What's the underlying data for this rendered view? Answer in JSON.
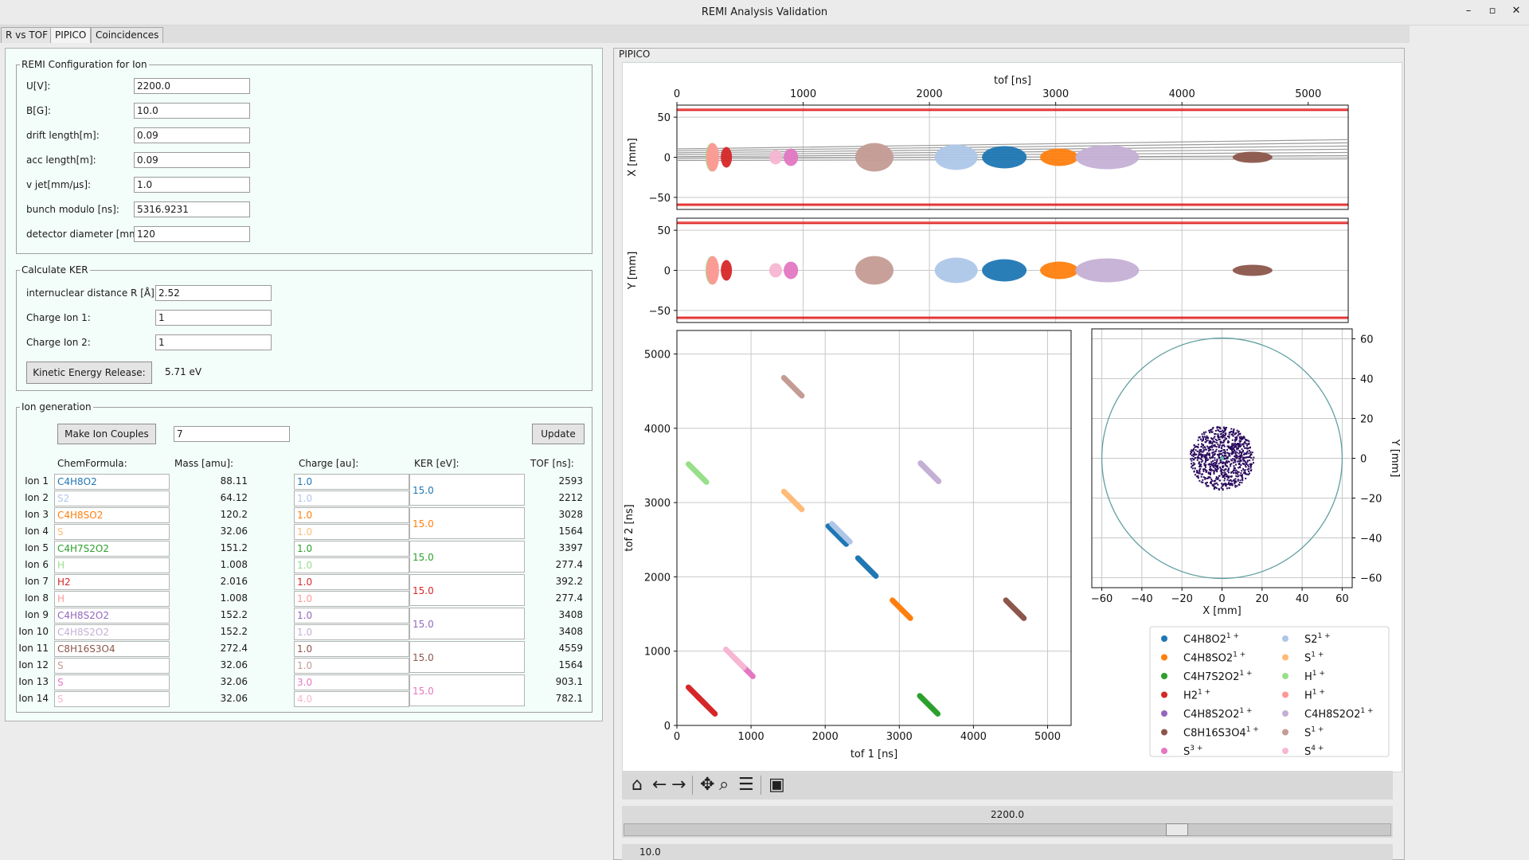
{
  "window": {
    "title": "REMI Analysis Validation",
    "minimize": "–",
    "maximize": "▫",
    "close": "✕"
  },
  "tabs": [
    "R vs TOF",
    "PIPICO",
    "Coincidences"
  ],
  "config": {
    "title": "REMI Configuration for Ion",
    "rows": [
      {
        "label": "U[V]:",
        "value": "2200.0"
      },
      {
        "label": "B[G]:",
        "value": "10.0"
      },
      {
        "label": "drift length[m]:",
        "value": "0.09"
      },
      {
        "label": "acc length[m]:",
        "value": "0.09"
      },
      {
        "label": "v jet[mm/µs]:",
        "value": "1.0"
      },
      {
        "label": "bunch modulo [ns]:",
        "value": "5316.9231"
      },
      {
        "label": "detector diameter [mm]:",
        "value": "120"
      }
    ]
  },
  "ker": {
    "title": "Calculate KER",
    "rows": [
      {
        "label": "internuclear distance R [Å]:",
        "value": "2.52"
      },
      {
        "label": "Charge Ion 1:",
        "value": "1"
      },
      {
        "label": "Charge Ion 2:",
        "value": "1"
      }
    ],
    "button": "Kinetic Energy Release:",
    "result": "5.71 eV"
  },
  "iongen": {
    "title": "Ion generation",
    "make_button": "Make Ion Couples",
    "couples": "7",
    "update_button": "Update",
    "headers": {
      "formula": "ChemFormula:",
      "mass": "Mass [amu]:",
      "charge": "Charge [au]:",
      "ker": "KER [eV]:",
      "tof": "TOF [ns]:"
    },
    "ions": [
      {
        "label": "Ion 1",
        "formula": "C4H8O2",
        "mass": "88.11",
        "charge": "1.0",
        "tof": "2593",
        "color": "#1f77b4"
      },
      {
        "label": "Ion 2",
        "formula": "S2",
        "mass": "64.12",
        "charge": "1.0",
        "tof": "2212",
        "color": "#aec7e8"
      },
      {
        "label": "Ion 3",
        "formula": "C4H8SO2",
        "mass": "120.2",
        "charge": "1.0",
        "tof": "3028",
        "color": "#ff7f0e"
      },
      {
        "label": "Ion 4",
        "formula": "S",
        "mass": "32.06",
        "charge": "1.0",
        "tof": "1564",
        "color": "#ffbb78"
      },
      {
        "label": "Ion 5",
        "formula": "C4H7S2O2",
        "mass": "151.2",
        "charge": "1.0",
        "tof": "3397",
        "color": "#2ca02c"
      },
      {
        "label": "Ion 6",
        "formula": "H",
        "mass": "1.008",
        "charge": "1.0",
        "tof": "277.4",
        "color": "#98df8a"
      },
      {
        "label": "Ion 7",
        "formula": "H2",
        "mass": "2.016",
        "charge": "1.0",
        "tof": "392.2",
        "color": "#d62728"
      },
      {
        "label": "Ion 8",
        "formula": "H",
        "mass": "1.008",
        "charge": "1.0",
        "tof": "277.4",
        "color": "#ff9896"
      },
      {
        "label": "Ion 9",
        "formula": "C4H8S2O2",
        "mass": "152.2",
        "charge": "1.0",
        "tof": "3408",
        "color": "#9467bd"
      },
      {
        "label": "Ion 10",
        "formula": "C4H8S2O2",
        "mass": "152.2",
        "charge": "1.0",
        "tof": "3408",
        "color": "#c5b0d5"
      },
      {
        "label": "Ion 11",
        "formula": "C8H16S3O4",
        "mass": "272.4",
        "charge": "1.0",
        "tof": "4559",
        "color": "#8c564b"
      },
      {
        "label": "Ion 12",
        "formula": "S",
        "mass": "32.06",
        "charge": "1.0",
        "tof": "1564",
        "color": "#c49c94"
      },
      {
        "label": "Ion 13",
        "formula": "S",
        "mass": "32.06",
        "charge": "3.0",
        "tof": "903.1",
        "color": "#e377c2"
      },
      {
        "label": "Ion 14",
        "formula": "S",
        "mass": "32.06",
        "charge": "4.0",
        "tof": "782.1",
        "color": "#f7b6d2"
      }
    ],
    "kers": [
      {
        "value": "15.0",
        "color": "#1f77b4"
      },
      {
        "value": "15.0",
        "color": "#ff7f0e"
      },
      {
        "value": "15.0",
        "color": "#2ca02c"
      },
      {
        "value": "15.0",
        "color": "#d62728"
      },
      {
        "value": "15.0",
        "color": "#9467bd"
      },
      {
        "value": "15.0",
        "color": "#8c564b"
      },
      {
        "value": "15.0",
        "color": "#e377c2"
      }
    ]
  },
  "pipico_title": "PIPICO",
  "chart_data": [
    {
      "type": "scatter",
      "xlabel": "tof [ns]",
      "ylabel": "X [mm]",
      "xlim": [
        0,
        5317
      ],
      "ylim": [
        -65,
        65
      ],
      "xticks": [
        "0",
        "1000",
        "2000",
        "3000",
        "4000",
        "5000"
      ],
      "yticks": [
        "50",
        "0",
        "−50"
      ],
      "detector_edge_mm": [
        60,
        -60
      ],
      "clusters": [
        {
          "tof": 277,
          "color": "#98df8a"
        },
        {
          "tof": 277,
          "color": "#ff9896"
        },
        {
          "tof": 392,
          "color": "#d62728"
        },
        {
          "tof": 782,
          "color": "#f7b6d2"
        },
        {
          "tof": 903,
          "color": "#e377c2"
        },
        {
          "tof": 1564,
          "color": "#c49c94"
        },
        {
          "tof": 2212,
          "color": "#aec7e8"
        },
        {
          "tof": 2593,
          "color": "#1f77b4"
        },
        {
          "tof": 3028,
          "color": "#ff7f0e"
        },
        {
          "tof": 3408,
          "color": "#c5b0d5"
        },
        {
          "tof": 4559,
          "color": "#8c564b"
        }
      ]
    },
    {
      "type": "scatter",
      "xlabel": "",
      "ylabel": "Y [mm]",
      "xlim": [
        0,
        5317
      ],
      "ylim": [
        -65,
        65
      ],
      "yticks": [
        "50",
        "0",
        "−50"
      ]
    },
    {
      "type": "scatter",
      "title": "PIPICO",
      "xlabel": "tof 1 [ns]",
      "ylabel": "tof 2 [ns]",
      "xlim": [
        0,
        5317
      ],
      "ylim": [
        0,
        5317
      ],
      "xticks": [
        "0",
        "1000",
        "2000",
        "3000",
        "4000",
        "5000"
      ],
      "yticks": [
        "0",
        "1000",
        "2000",
        "3000",
        "4000",
        "5000"
      ],
      "pairs": [
        {
          "color": "#1f77b4",
          "tof1": 2593,
          "tof2": 2212
        },
        {
          "color": "#ff7f0e",
          "tof1": 3028,
          "tof2": 1564
        },
        {
          "color": "#2ca02c",
          "tof1": 3397,
          "tof2": 277
        },
        {
          "color": "#d62728",
          "tof1": 392,
          "tof2": 277
        },
        {
          "color": "#9467bd",
          "tof1": 3408,
          "tof2": 3408
        },
        {
          "color": "#8c564b",
          "tof1": 4559,
          "tof2": 1564
        },
        {
          "color": "#e377c2",
          "tof1": 903,
          "tof2": 782
        }
      ]
    },
    {
      "type": "scatter",
      "xlabel": "X [mm]",
      "ylabel": "Y [mm]",
      "xlim": [
        -65,
        65
      ],
      "ylim": [
        -65,
        65
      ],
      "xticks": [
        "−60",
        "−40",
        "−20",
        "0",
        "20",
        "40",
        "60"
      ],
      "yticks": [
        "60",
        "40",
        "20",
        "0",
        "−20",
        "−40",
        "−60"
      ],
      "detector_radius_mm": 60,
      "spot_color": "#2a0a5e"
    }
  ],
  "legend": [
    {
      "base": "C4H8O2",
      "sup": "1 +",
      "color": "#1f77b4"
    },
    {
      "base": "S2",
      "sup": "1 +",
      "color": "#aec7e8"
    },
    {
      "base": "C4H8SO2",
      "sup": "1 +",
      "color": "#ff7f0e"
    },
    {
      "base": "S",
      "sup": "1 +",
      "color": "#ffbb78"
    },
    {
      "base": "C4H7S2O2",
      "sup": "1 +",
      "color": "#2ca02c"
    },
    {
      "base": "H",
      "sup": "1 +",
      "color": "#98df8a"
    },
    {
      "base": "H2",
      "sup": "1 +",
      "color": "#d62728"
    },
    {
      "base": "H",
      "sup": "1 +",
      "color": "#ff9896"
    },
    {
      "base": "C4H8S2O2",
      "sup": "1 +",
      "color": "#9467bd"
    },
    {
      "base": "C4H8S2O2",
      "sup": "1 +",
      "color": "#c5b0d5"
    },
    {
      "base": "C8H16S3O4",
      "sup": "1 +",
      "color": "#8c564b"
    },
    {
      "base": "S",
      "sup": "1 +",
      "color": "#c49c94"
    },
    {
      "base": "S",
      "sup": "3 +",
      "color": "#e377c2"
    },
    {
      "base": "S",
      "sup": "4 +",
      "color": "#f7b6d2"
    }
  ],
  "toolbar": [
    {
      "name": "home-icon",
      "glyph": "⌂"
    },
    {
      "name": "back-icon",
      "glyph": "←"
    },
    {
      "name": "forward-icon",
      "glyph": "→"
    },
    {
      "name": "pan-icon",
      "glyph": "✥"
    },
    {
      "name": "zoom-icon",
      "glyph": "⌕"
    },
    {
      "name": "configure-icon",
      "glyph": "☰"
    },
    {
      "name": "save-icon",
      "glyph": "▣"
    }
  ],
  "sliders": {
    "voltage_label": "2200.0",
    "voltage_fraction": 0.726,
    "field_label": "10.0"
  }
}
